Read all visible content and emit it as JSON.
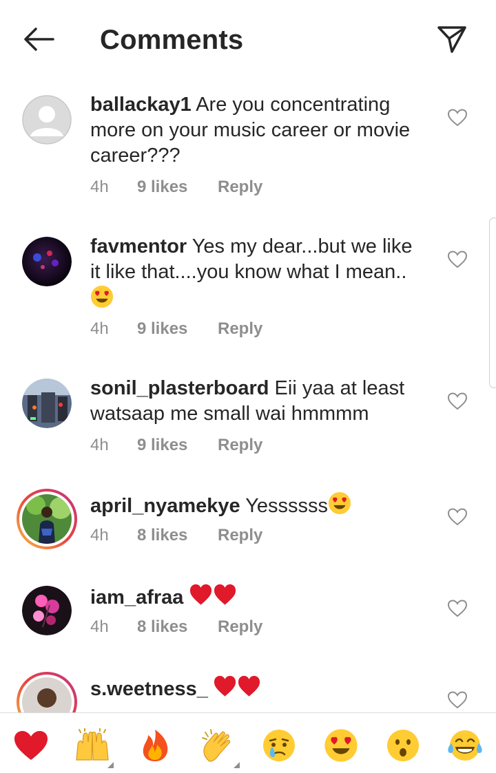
{
  "header": {
    "title": "Comments",
    "back_icon": "arrow-left-icon",
    "send_icon": "paper-plane-icon"
  },
  "comments": [
    {
      "username": "ballackay1",
      "text": "Are you concentrating more on your music career or movie career???",
      "time": "4h",
      "likes": "9 likes",
      "reply": "Reply",
      "avatar": "default-avatar"
    },
    {
      "username": "favmentor",
      "text_line1": "Yes my dear...but we like it like that....you know what I mean..",
      "emoji": "smiling-face-heart-eyes",
      "time": "4h",
      "likes": "9 likes",
      "reply": "Reply",
      "avatar": "dark-blue-photo"
    },
    {
      "username": "sonil_plasterboard",
      "text": "Eii yaa at least watsaap me small wai hmmmm",
      "time": "4h",
      "likes": "9 likes",
      "reply": "Reply",
      "avatar": "room-photo"
    },
    {
      "username": "april_nyamekye",
      "text": "Yessssss",
      "emoji": "smiling-face-heart-eyes",
      "time": "4h",
      "likes": "8 likes",
      "reply": "Reply",
      "avatar": "woman-photo",
      "story_ring": true
    },
    {
      "username": "iam_afraa",
      "emoji": "two-red-hearts",
      "time": "4h",
      "likes": "8 likes",
      "reply": "Reply",
      "avatar": "pink-flowers-photo"
    },
    {
      "username": "s.weetness_",
      "emoji": "two-red-hearts",
      "avatar": "woman-photo-2",
      "story_ring": true
    }
  ],
  "quick_emojis": [
    "red-heart",
    "raising-hands",
    "fire",
    "clapping-hands",
    "crying-face",
    "heart-eyes",
    "surprised-face",
    "tears-of-joy"
  ],
  "colors": {
    "text": "#262626",
    "muted": "#8e8e8e",
    "heart_red": "#e0192b",
    "story_gradient": [
      "#f9c144",
      "#e8433f",
      "#c13584"
    ]
  }
}
